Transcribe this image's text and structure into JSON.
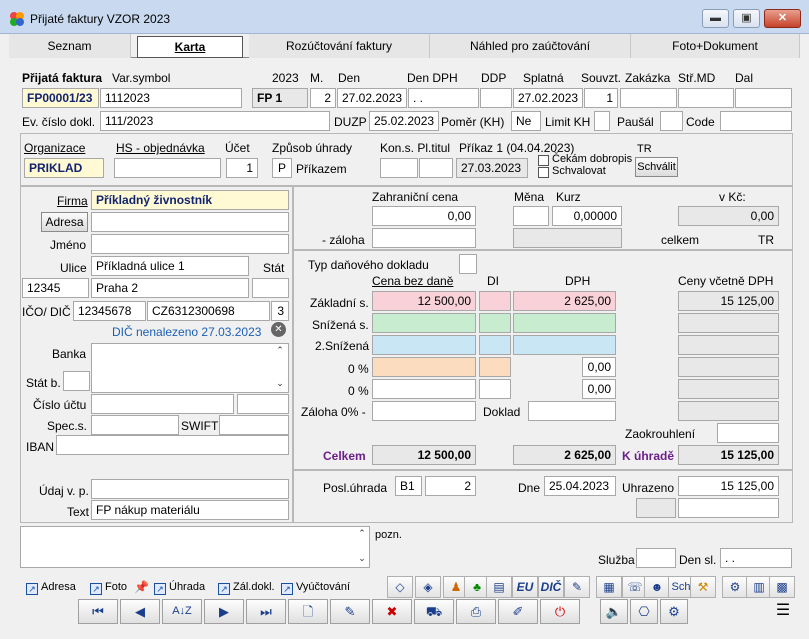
{
  "window": {
    "title": "Přijaté faktury VZOR  2023",
    "min": "▬",
    "max": "▣",
    "close": "✕"
  },
  "tabs": [
    "Seznam",
    "Karta",
    "Rozúčtování faktury",
    "Náhled pro zaúčtování",
    "Foto+Dokument"
  ],
  "header": {
    "l_prijata": "Přijatá faktura",
    "l_varsym": "Var.symbol",
    "l_year": "2023",
    "l_m": "M.",
    "l_den": "Den",
    "l_dendph": "Den DPH",
    "l_ddp": "DDP",
    "l_splatna": "Splatná",
    "l_souvzt": "Souvzt.",
    "l_zakazka": "Zakázka",
    "l_strmd": "Stř.MD",
    "l_dal": "Dal",
    "doc_no": "FP00001/23",
    "varsym": "1112023",
    "fp": "FP  1",
    "m": "2",
    "den": "27.02.2023",
    "dendph": " .  .",
    "splatna": "27.02.2023",
    "souvzt": "1",
    "l_evcislo": "Ev. číslo dokl.",
    "evcislo": "111/2023",
    "l_duzp": "DUZP",
    "duzp": "25.02.2023",
    "l_pomer": "Poměr (KH)",
    "pomer": "Ne",
    "l_limit": "Limit KH",
    "l_pausal": "Paušál",
    "l_code": "Code"
  },
  "org": {
    "l_org": "Organizace",
    "org": "PRIKLAD",
    "l_hs": "HS - objednávka",
    "l_ucet": "Účet",
    "ucet": "1",
    "l_zpusob": "Způsob úhrady",
    "zpusob_code": "P",
    "zpusob": "Příkazem",
    "l_kons": "Kon.s. Pl.titul",
    "l_prikaz": "Příkaz 1 (04.04.2023)",
    "prikaz_date": "27.03.2023",
    "l_tr": "TR",
    "l_cekam": "Čekám dobropis",
    "l_schvalovat": "Schvalovat",
    "schvalit": "Schválit"
  },
  "partner": {
    "l_firma": "Firma",
    "firma": "Příkladný živnostník",
    "adresa_btn": "Adresa",
    "l_jmeno": "Jméno",
    "l_ulice": "Ulice",
    "ulice": "Příkladná ulice 1",
    "l_stat": "Stát",
    "psc": "12345",
    "mesto": "Praha 2",
    "l_ico": "IČO/ DIČ",
    "ico": "12345678",
    "dic": "CZ6312300698",
    "ico_n": "3",
    "dic_status": "DIČ nenalezeno 27.03.2023",
    "l_banka": "Banka",
    "l_statb": "Stát b.",
    "l_cislo": "Číslo účtu",
    "l_spec": "Spec.s.",
    "l_swift": "SWIFT",
    "l_iban": "IBAN",
    "l_udaj": "Údaj v. p.",
    "l_text": "Text",
    "text": "FP nákup materiálu"
  },
  "amounts": {
    "l_zahr": "Zahraniční cena",
    "zahr": "0,00",
    "l_mena": "Měna",
    "l_kurz": "Kurz",
    "kurz": "0,00000",
    "l_vkc": "v Kč:",
    "vkc": "0,00",
    "l_zaloha": "- záloha",
    "l_celkem_tr": "celkem",
    "l_tr": "TR",
    "l_typ": "Typ daňového dokladu",
    "l_cena_bez": "Cena bez daně",
    "l_di": "DI",
    "l_dph": "DPH",
    "l_ceny_vc": "Ceny včetně DPH",
    "rows": [
      {
        "label": "Základní s.",
        "bez": "12 500,00",
        "dph": "2 625,00",
        "vc": "15 125,00"
      },
      {
        "label": "Snížená s.",
        "bez": "",
        "dph": "",
        "vc": ""
      },
      {
        "label": "2.Snížená",
        "bez": "",
        "dph": "",
        "vc": ""
      },
      {
        "label": "0 %",
        "bez": "",
        "dph": "0,00",
        "vc": ""
      },
      {
        "label": "0 %",
        "bez": "",
        "dph": "0,00",
        "vc": ""
      }
    ],
    "l_zaloha0": "Záloha 0% -",
    "l_doklad": "Doklad",
    "l_zaokr": "Zaokrouhlení",
    "l_celkem": "Celkem",
    "celkem_bez": "12 500,00",
    "celkem_dph": "2 625,00",
    "l_kuhrade": "K úhradě",
    "kuhrade": "15 125,00",
    "l_posl": "Posl.úhrada",
    "posl_code": "B1",
    "posl_n": "2",
    "l_dne": "Dne",
    "dne": "25.04.2023",
    "l_uhrazeno": "Uhrazeno",
    "uhrazeno": "15 125,00"
  },
  "notes": {
    "l_pozn": "pozn.",
    "l_sluzba": "Služba",
    "l_densl": "Den sl.",
    "densl": " .  ."
  },
  "links": [
    "Adresa",
    "Foto",
    "Úhrada",
    "Zál.dokl.",
    "Vyúčtování"
  ],
  "toolbar": {
    "eu": "EU",
    "dic": "DIČ",
    "sch": "Sch"
  },
  "nav": [
    "⏮",
    "◀",
    "A↓Z",
    "▶",
    "⏭",
    "🗋",
    "✎",
    "✖",
    "⛟",
    "⎙",
    "✐",
    "⏻",
    "🔈",
    "⎔",
    "⚙",
    "☰"
  ]
}
